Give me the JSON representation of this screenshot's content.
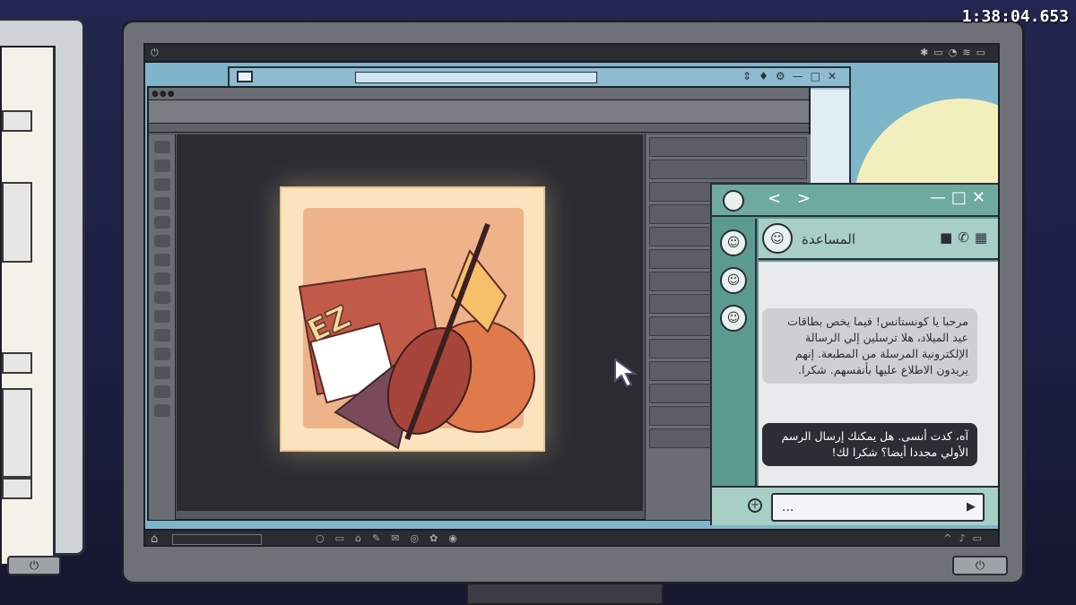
{
  "timer": "1:38:04.653",
  "chat": {
    "contact_name": "المساعدة",
    "incoming_message": "مرحبا يا كونستانس! فيما يخص بطاقات عيد الميلاد، هلا ترسلين إلي الرسالة الإلكترونية المرسلة من المطبعة. إنهم يريدون الاطلاع عليها بأنفسهم. شكرا.",
    "outgoing_message": "آه، كدت أنسى. هل يمكنك إرسال الرسم الأولي مجددا أيضا؟ شكرا لك!",
    "input_placeholder": "...",
    "nav_back": "<",
    "nav_forward": ">"
  },
  "artwork": {
    "label": "EZ"
  },
  "icons": {
    "power": "power-icon",
    "home": "home-icon",
    "mail": "mail-icon",
    "send": "send-icon",
    "add": "add-icon",
    "cursor": "cursor-icon"
  },
  "colors": {
    "chat_accent": "#5b9a8f",
    "chat_header": "#a7cfc6",
    "wallpaper": "#7fb5c9",
    "moon": "#f3efbd",
    "art_paper": "#fbe3bd"
  }
}
